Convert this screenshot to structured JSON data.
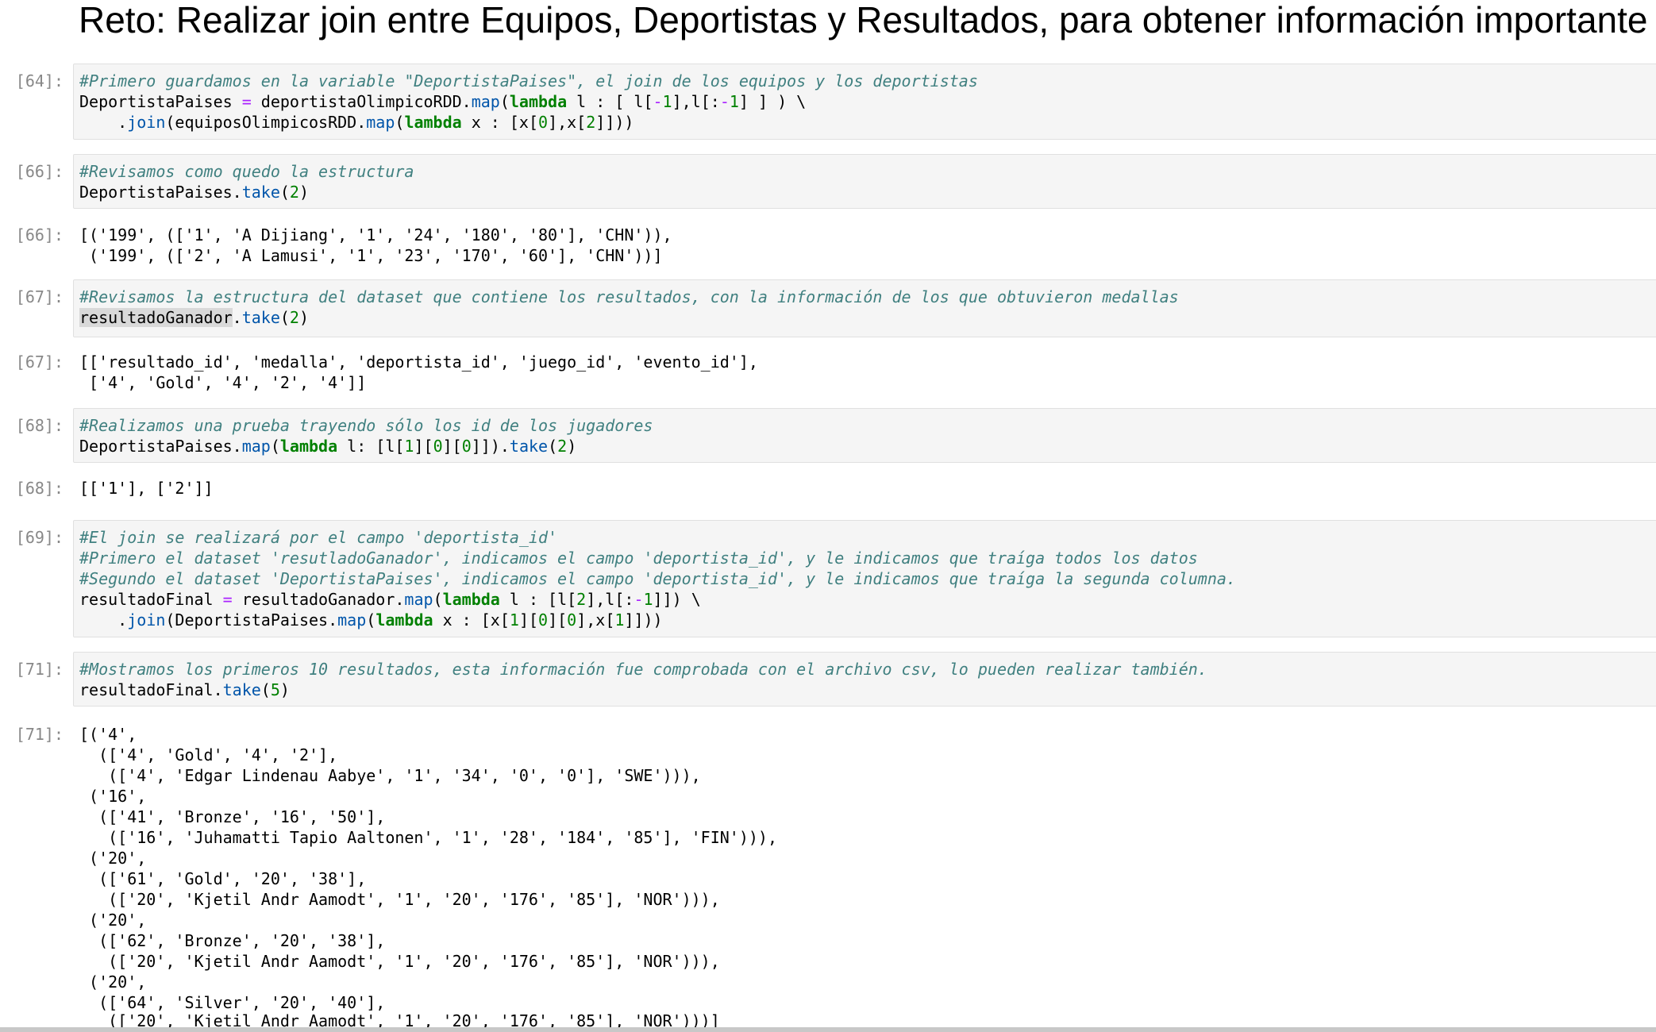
{
  "heading": "Reto: Realizar join entre Equipos, Deportistas y Resultados, para obtener información importante",
  "cells": [
    {
      "prompt": "[64]:",
      "kind": "input",
      "comment": "#Primero guardamos en la variable \"DeportistaPaises\", el join de los equipos y los deportistas",
      "line1": "DeportistaPaises = deportistaOlimpicoRDD.map(lambda l : [ l[-1],l[:-1] ] ) \\",
      "line2": "    .join(equiposOlimpicosRDD.map(lambda x : [x[0],x[2]]))"
    },
    {
      "prompt": "[66]:",
      "kind": "input",
      "comment": "#Revisamos como quedo la estructura",
      "line1": "DeportistaPaises.take(2)"
    },
    {
      "prompt": "[66]:",
      "kind": "output",
      "lines": [
        "[('199', (['1', 'A Dijiang', '1', '24', '180', '80'], 'CHN')),",
        " ('199', (['2', 'A Lamusi', '1', '23', '170', '60'], 'CHN'))]"
      ]
    },
    {
      "prompt": "[67]:",
      "kind": "input",
      "comment": "#Revisamos la estructura del dataset que contiene los resultados, con la información de los que obtuvieron medallas",
      "line1": "resultadoGanador.take(2)"
    },
    {
      "prompt": "[67]:",
      "kind": "output",
      "lines": [
        "[['resultado_id', 'medalla', 'deportista_id', 'juego_id', 'evento_id'],",
        " ['4', 'Gold', '4', '2', '4']]"
      ]
    },
    {
      "prompt": "[68]:",
      "kind": "input",
      "comment": "#Realizamos una prueba trayendo sólo los id de los jugadores",
      "line1": "DeportistaPaises.map(lambda l: [l[1][0][0]]).take(2)"
    },
    {
      "prompt": "[68]:",
      "kind": "output",
      "lines": [
        "[['1'], ['2']]"
      ]
    },
    {
      "prompt": "[69]:",
      "kind": "input",
      "comments": [
        "#El join se realizará por el campo 'deportista_id'",
        "#Primero el dataset 'resutladoGanador', indicamos el campo 'deportista_id', y le indicamos que traíga todos los datos",
        "#Segundo el dataset 'DeportistaPaises', indicamos el campo 'deportista_id', y le indicamos que traíga la segunda columna."
      ],
      "line1": "resultadoFinal = resultadoGanador.map(lambda l : [l[2],l[:-1]]) \\",
      "line2": "    .join(DeportistaPaises.map(lambda x : [x[1][0][0],x[1]]))"
    },
    {
      "prompt": "[71]:",
      "kind": "input",
      "comment": "#Mostramos los primeros 10 resultados, esta información fue comprobada con el archivo csv, lo pueden realizar también.",
      "line1": "resultadoFinal.take(5)"
    },
    {
      "prompt": "[71]:",
      "kind": "output",
      "lines": [
        "[('4',",
        "  (['4', 'Gold', '4', '2'],",
        "   (['4', 'Edgar Lindenau Aabye', '1', '34', '0', '0'], 'SWE'))),",
        " ('16',",
        "  (['41', 'Bronze', '16', '50'],",
        "   (['16', 'Juhamatti Tapio Aaltonen', '1', '28', '184', '85'], 'FIN'))),",
        " ('20',",
        "  (['61', 'Gold', '20', '38'],",
        "   (['20', 'Kjetil Andr Aamodt', '1', '20', '176', '85'], 'NOR'))),",
        " ('20',",
        "  (['62', 'Bronze', '20', '38'],",
        "   (['20', 'Kjetil Andr Aamodt', '1', '20', '176', '85'], 'NOR'))),",
        " ('20',",
        "  (['64', 'Silver', '20', '40'],",
        "   (['20', 'Kjetil Andr Aamodt', '1', '20', '176', '85'], 'NOR')))]"
      ]
    }
  ]
}
